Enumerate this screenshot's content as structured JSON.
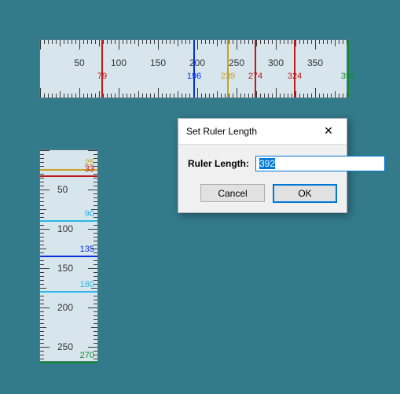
{
  "hruler": {
    "length": 392,
    "tick_minor": 5,
    "tick_mid": 25,
    "tick_major": 50,
    "labels": [
      50,
      100,
      150,
      200,
      250,
      300,
      350
    ],
    "markers": [
      {
        "pos": 79,
        "color": "#c01818",
        "label": "79",
        "label_color": "#c01818"
      },
      {
        "pos": 196,
        "color": "#0a2fe0",
        "label": "196",
        "label_color": "#0a2fe0"
      },
      {
        "pos": 239,
        "color": "#c9a227",
        "label": "239",
        "label_color": "#c9a227"
      },
      {
        "pos": 274,
        "color": "#c01818",
        "label": "274",
        "label_color": "#c01818"
      },
      {
        "pos": 324,
        "color": "#c01818",
        "label": "324",
        "label_color": "#c01818"
      },
      {
        "pos": 392,
        "color": "#118a2e",
        "label": "392",
        "label_color": "#118a2e"
      }
    ]
  },
  "vruler": {
    "length": 270,
    "tick_minor": 5,
    "tick_mid": 25,
    "tick_major": 50,
    "labels": [
      50,
      100,
      150,
      200,
      250
    ],
    "markers": [
      {
        "pos": 25,
        "color": "#c9a227",
        "label": "25",
        "label_color": "#c9a227"
      },
      {
        "pos": 33,
        "color": "#c01818",
        "label": "33",
        "label_color": "#c01818"
      },
      {
        "pos": 90,
        "color": "#2bb6e6",
        "label": "90",
        "label_color": "#2bb6e6"
      },
      {
        "pos": 135,
        "color": "#0a2fe0",
        "label": "135",
        "label_color": "#0a2fe0"
      },
      {
        "pos": 180,
        "color": "#2bb6e6",
        "label": "180",
        "label_color": "#2bb6e6"
      },
      {
        "pos": 270,
        "color": "#118a2e",
        "label": "270",
        "label_color": "#118a2e"
      }
    ]
  },
  "dialog": {
    "title": "Set Ruler Length",
    "field_label": "Ruler Length:",
    "value": "392",
    "cancel": "Cancel",
    "ok": "OK"
  }
}
